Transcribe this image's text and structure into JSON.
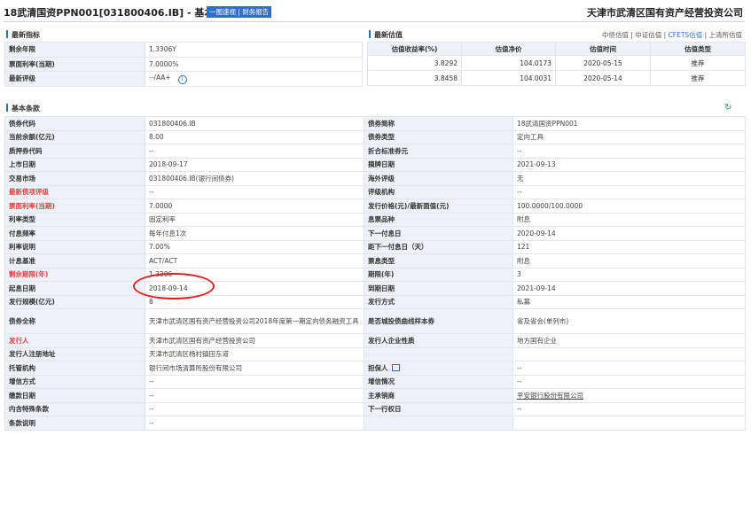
{
  "header": {
    "title": "18武清国资PPN001[031800406.IB] - 基本条款",
    "btn_one_glance": "一图速视",
    "btn_sep": " | ",
    "btn_financial": "财务报告",
    "issuer_name": "天津市武清区国有资产经营投资公司"
  },
  "latest_indicators": {
    "heading": "最新指标",
    "rows": [
      {
        "label": "剩余年限",
        "value": "1.3306Y"
      },
      {
        "label": "票面利率(当期)",
        "value": "7.0000%"
      },
      {
        "label": "最新评级",
        "value": "--/AA+"
      }
    ]
  },
  "latest_valuation": {
    "heading": "最新估值",
    "links": [
      "中债估值",
      "中证估值",
      "CFETS估值",
      "上清所估值"
    ],
    "active_link": "CFETS估值",
    "columns": [
      "估值收益率(%)",
      "估值净价",
      "估值时间",
      "估值类型"
    ],
    "rows": [
      {
        "yield": "3.8292",
        "net_price": "104.0173",
        "date": "2020-05-15",
        "type": "推荐"
      },
      {
        "yield": "3.8458",
        "net_price": "104.0031",
        "date": "2020-05-14",
        "type": "推荐"
      }
    ]
  },
  "basic_terms": {
    "heading": "基本条款",
    "rows": [
      {
        "l1": "债券代码",
        "v1": "031800406.IB",
        "l2": "债券简称",
        "v2": "18武清国资PPN001"
      },
      {
        "l1": "当前余额(亿元)",
        "v1": "8.00",
        "l2": "债券类型",
        "v2": "定向工具"
      },
      {
        "l1": "质押券代码",
        "v1": "--",
        "l2": "折合标准券元",
        "v2": "--"
      },
      {
        "l1": "上市日期",
        "v1": "2018-09-17",
        "l2": "摘牌日期",
        "v2": "2021-09-13"
      },
      {
        "l1": "交易市场",
        "v1": "031800406.IB(银行间债券)",
        "l2": "海外评级",
        "v2": "无"
      },
      {
        "l1": "最新债项评级",
        "v1": "--",
        "l2": "评级机构",
        "v2": "--"
      },
      {
        "l1": "票面利率(当期)",
        "v1": "7.0000",
        "l2": "发行价格(元)/最新面值(元)",
        "v2": "100.0000/100.0000"
      },
      {
        "l1": "利率类型",
        "v1": "固定利率",
        "l2": "息票品种",
        "v2": "附息"
      },
      {
        "l1": "付息频率",
        "v1": "每年付息1次",
        "l2": "下一付息日",
        "v2": "2020-09-14"
      },
      {
        "l1": "利率说明",
        "v1": "7.00%",
        "l2": "距下一付息日（天）",
        "v2": "121"
      },
      {
        "l1": "计息基准",
        "v1": "ACT/ACT",
        "l2": "票息类型",
        "v2": "附息"
      },
      {
        "l1": "剩余期限(年)",
        "v1": "1.3306",
        "l2": "期限(年)",
        "v2": "3"
      },
      {
        "l1": "起息日期",
        "v1": "2018-09-14",
        "l2": "到期日期",
        "v2": "2021-09-14"
      },
      {
        "l1": "发行规模(亿元)",
        "v1": "8",
        "l2": "发行方式",
        "v2": "私募"
      },
      {
        "l1": "债券全称",
        "v1": "天津市武清区国有资产经营投资公司2018年度第一期定向债务融资工具",
        "l2": "是否城投债曲线样本券",
        "v2": "省及省会(单列市)"
      },
      {
        "l1": "发行人",
        "v1": "天津市武清区国有资产经营投资公司",
        "l2": "发行人企业性质",
        "v2": "地方国有企业"
      },
      {
        "l1": "发行人注册地址",
        "v1": "天津市武清区杨村镇田东道",
        "l2": "",
        "v2": ""
      },
      {
        "l1": "托管机构",
        "v1": "银行间市场清算所股份有限公司",
        "l2": "担保人",
        "v2": "--"
      },
      {
        "l1": "增信方式",
        "v1": "--",
        "l2": "增信情况",
        "v2": "--"
      },
      {
        "l1": "缴款日期",
        "v1": "--",
        "l2": "主承销商",
        "v2": "平安银行股份有限公司"
      },
      {
        "l1": "内含特殊条款",
        "v1": "--",
        "l2": "下一行权日",
        "v2": "--"
      },
      {
        "l1": "条款说明",
        "v1": "--",
        "l2": "",
        "v2": ""
      }
    ]
  }
}
